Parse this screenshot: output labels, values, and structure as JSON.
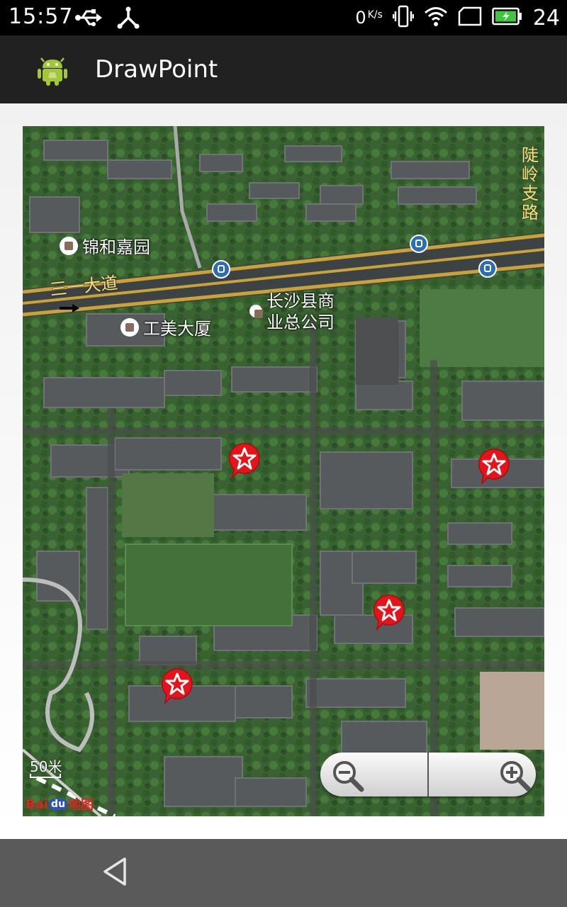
{
  "status_bar": {
    "time": "15:57",
    "net_speed": "0",
    "net_speed_unit": "K/s",
    "battery_level": "24",
    "icons": [
      "usb-icon",
      "sync-icon",
      "vibrate-icon",
      "wifi-icon",
      "sim-icon",
      "battery-charging-icon"
    ]
  },
  "app_bar": {
    "title": "DrawPoint",
    "icon": "android-icon"
  },
  "map": {
    "pois": {
      "jinhejiayuan": "锦和嘉园",
      "gongmei": "工美大厦",
      "changsha_line1": "长沙县商",
      "changsha_line2": "业总公司"
    },
    "roads": {
      "sanyi": "三一大道",
      "luling": "陡岭支路"
    },
    "scale_label": "50米",
    "logo": {
      "bai": "Bai",
      "du": "du",
      "map": "地图"
    },
    "marker_count": 4
  },
  "nav_bar": {
    "back_icon": "back-icon"
  },
  "colors": {
    "status_bar": "#000000",
    "app_bar": "#212121",
    "nav_bar": "#5a5a5a",
    "marker": "#e5141b",
    "road_label": "#f7e07a"
  }
}
